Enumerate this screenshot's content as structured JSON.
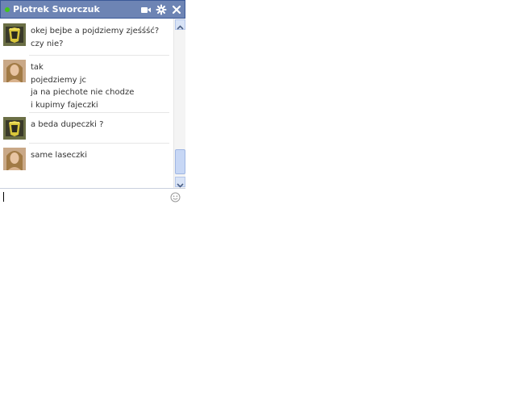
{
  "chat": {
    "contact_name": "Piotrek Sworczuk",
    "status": "online",
    "icons": [
      "video-call-icon",
      "gear-icon",
      "close-icon"
    ],
    "messages": [
      {
        "sender": "contact",
        "lines": [
          "okej bejbe a pojdziemy zjeśśść?",
          "czy nie?"
        ]
      },
      {
        "sender": "self",
        "lines": [
          "tak",
          "pojedziemy jc",
          "ja na piechote nie chodze",
          "i kupimy fajeczki"
        ]
      },
      {
        "sender": "contact",
        "lines": [
          "a beda dupeczki ?"
        ]
      },
      {
        "sender": "self",
        "lines": [
          "same laseczki"
        ]
      }
    ],
    "input": {
      "value": "",
      "placeholder": ""
    },
    "emoticon_icon": "smiley-icon"
  },
  "colors": {
    "titlebar": "#6d84b4",
    "titlebar_border": "#3b5998",
    "online": "#43c61a"
  }
}
